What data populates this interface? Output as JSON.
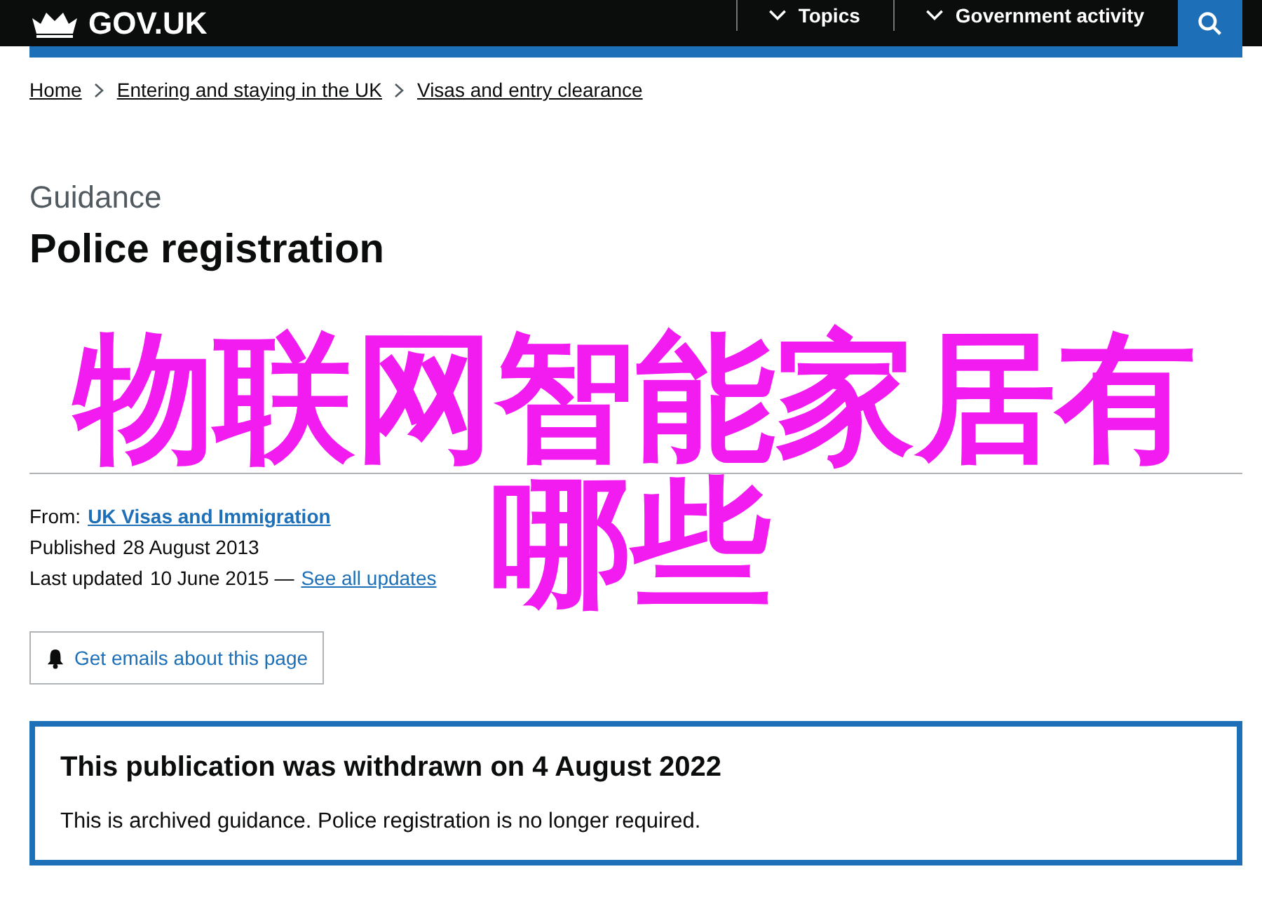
{
  "header": {
    "logo": "GOV.UK",
    "nav": [
      {
        "label": "Topics"
      },
      {
        "label": "Government activity"
      }
    ]
  },
  "breadcrumbs": [
    "Home",
    "Entering and staying in the UK",
    "Visas and entry clearance"
  ],
  "page": {
    "caption": "Guidance",
    "title": "Police registration"
  },
  "metadata": {
    "from_label": "From:",
    "from_link": "UK Visas and Immigration",
    "published_label": "Published",
    "published": "28 August 2013",
    "updated_label": "Last updated",
    "updated": "10 June 2015 —",
    "updates_link": "See all updates"
  },
  "email_button": "Get emails about this page",
  "notice": {
    "title": "This publication was withdrawn on 4 August 2022",
    "body": "This is archived guidance. Police registration is no longer required."
  },
  "overlay": {
    "lines": [
      "物联网智能家居有",
      "哪些"
    ]
  }
}
